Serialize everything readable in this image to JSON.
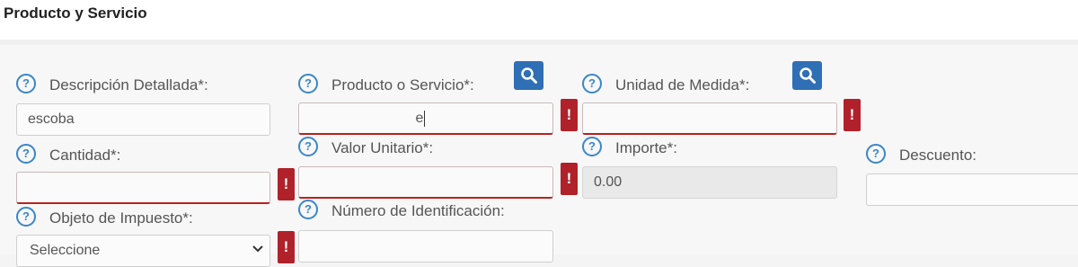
{
  "section_title": "Producto y Servicio",
  "help_glyph": "?",
  "error_glyph": "!",
  "fields": {
    "descripcion": {
      "label": "Descripción Detallada*:",
      "value": "escoba"
    },
    "producto": {
      "label": "Producto o Servicio*:",
      "value": "e"
    },
    "unidad": {
      "label": "Unidad de Medida*:",
      "value": ""
    },
    "cantidad": {
      "label": "Cantidad*:",
      "value": ""
    },
    "valor_unitario": {
      "label": "Valor Unitario*:",
      "value": ""
    },
    "importe": {
      "label": "Importe*:",
      "value": "0.00"
    },
    "descuento": {
      "label": "Descuento:",
      "value": ""
    },
    "objeto_impuesto": {
      "label": "Objeto de Impuesto*:",
      "value": "Seleccione"
    },
    "numero_identificacion": {
      "label": "Número de Identificación:",
      "value": ""
    }
  },
  "icons": {
    "help": "question-circle",
    "search": "magnifier",
    "error": "exclamation",
    "select": "chevron-down"
  },
  "colors": {
    "accent_blue": "#3a86c8",
    "button_blue": "#2f6fb5",
    "error_red": "#b0212a"
  }
}
